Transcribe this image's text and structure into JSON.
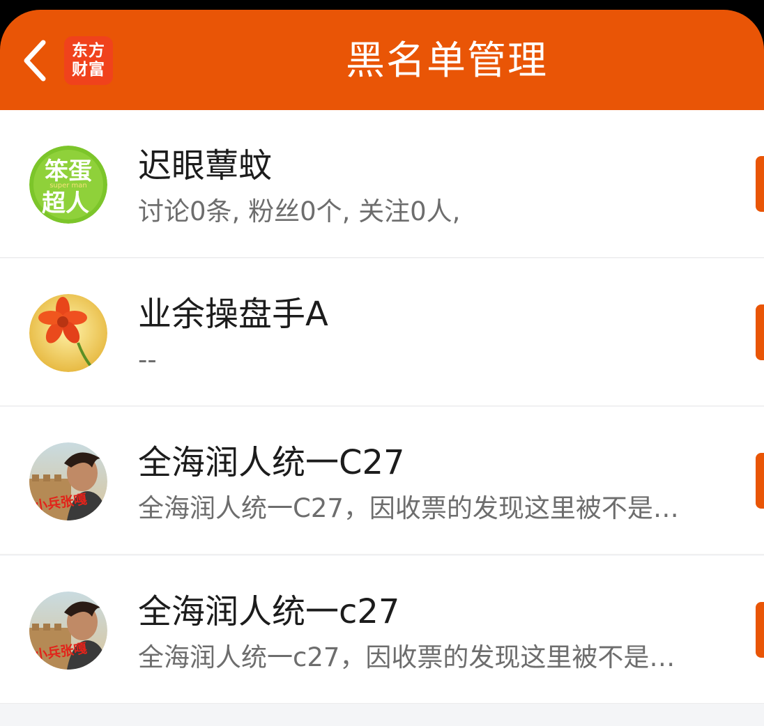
{
  "header": {
    "title": "黑名单管理",
    "logo_line1": "东方",
    "logo_line2": "财富",
    "brand_color": "#e95506"
  },
  "list": [
    {
      "name": "迟眼蕈蚊",
      "desc": "讨论0条, 粉丝0个, 关注0人,",
      "avatar_icon": "green-cartoon-avatar-icon",
      "avatar_text_top": "笨蛋",
      "avatar_text_bottom": "超人",
      "avatar_text_mid": "super man"
    },
    {
      "name": "业余操盘手A",
      "desc": "--",
      "avatar_icon": "orange-flower-avatar-icon"
    },
    {
      "name": "全海润人统一C27",
      "desc": "全海润人统一C27，因收票的发现这里被不是…",
      "avatar_icon": "photo-portrait-avatar-icon",
      "avatar_caption": "小兵张嘎"
    },
    {
      "name": "全海润人统一c27",
      "desc": "全海润人统一c27，因收票的发现这里被不是…",
      "avatar_icon": "photo-portrait-avatar-icon",
      "avatar_caption": "小兵张嘎"
    }
  ]
}
